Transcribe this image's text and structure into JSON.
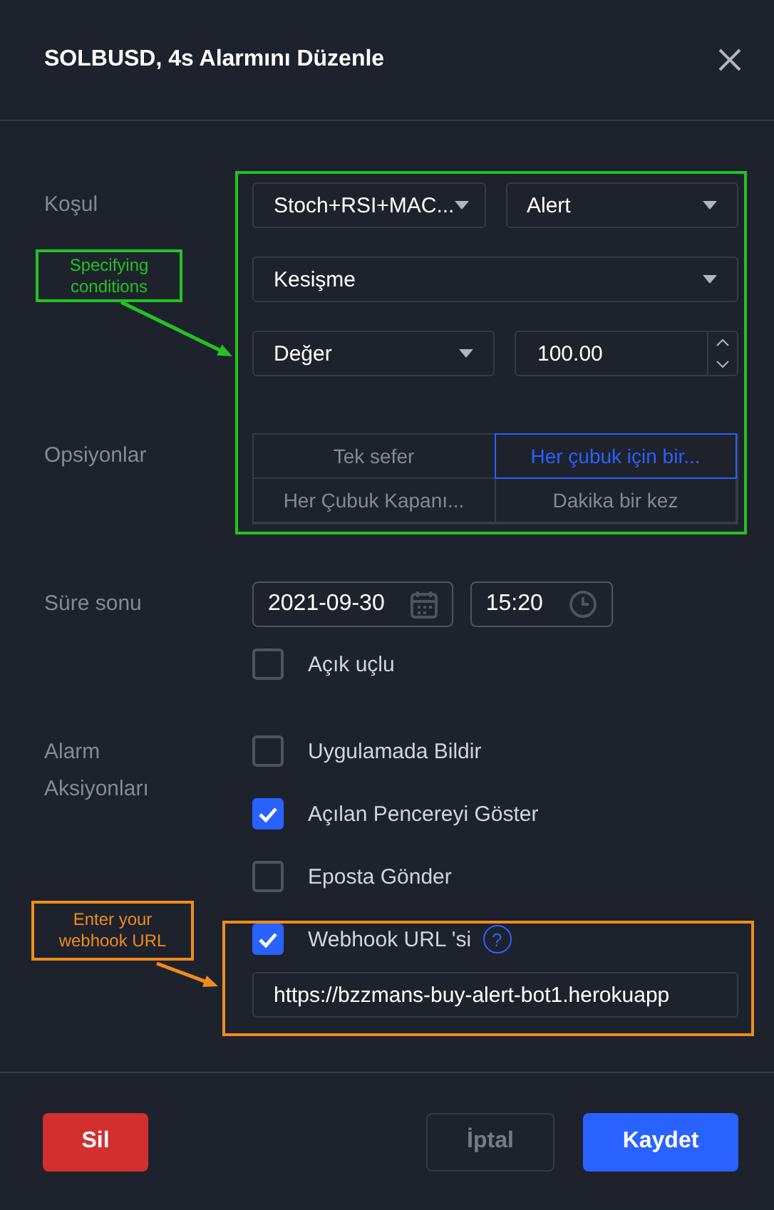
{
  "dialog": {
    "title": "SOLBUSD, 4s Alarmını Düzenle"
  },
  "condition": {
    "label": "Koşul",
    "source": "Stoch+RSI+MAC...",
    "plot": "Alert",
    "operator": "Kesişme",
    "value_type": "Değer",
    "value": "100.00"
  },
  "options": {
    "label": "Opsiyonlar",
    "items": [
      {
        "label": "Tek sefer",
        "selected": false
      },
      {
        "label": "Her çubuk için bir...",
        "selected": true
      },
      {
        "label": "Her Çubuk Kapanı...",
        "selected": false
      },
      {
        "label": "Dakika bir kez",
        "selected": false
      }
    ]
  },
  "expiration": {
    "label": "Süre sonu",
    "date": "2021-09-30",
    "time": "15:20",
    "open_ended": {
      "label": "Açık uçlu",
      "checked": false
    }
  },
  "actions": {
    "label": "Alarm Aksiyonları",
    "items": [
      {
        "label": "Uygulamada Bildir",
        "checked": false
      },
      {
        "label": "Açılan Pencereyi Göster",
        "checked": true
      },
      {
        "label": "Eposta Gönder",
        "checked": false
      },
      {
        "label": "Webhook URL 'si",
        "checked": true,
        "help": "?"
      }
    ],
    "webhook_url": "https://bzzmans-buy-alert-bot1.herokuapp"
  },
  "buttons": {
    "delete": "Sil",
    "cancel": "İptal",
    "save": "Kaydet"
  },
  "annotations": [
    {
      "text": "Specifying conditions",
      "color": "#22c322"
    },
    {
      "text": "Enter your webhook URL",
      "color": "#f08c1e"
    }
  ]
}
